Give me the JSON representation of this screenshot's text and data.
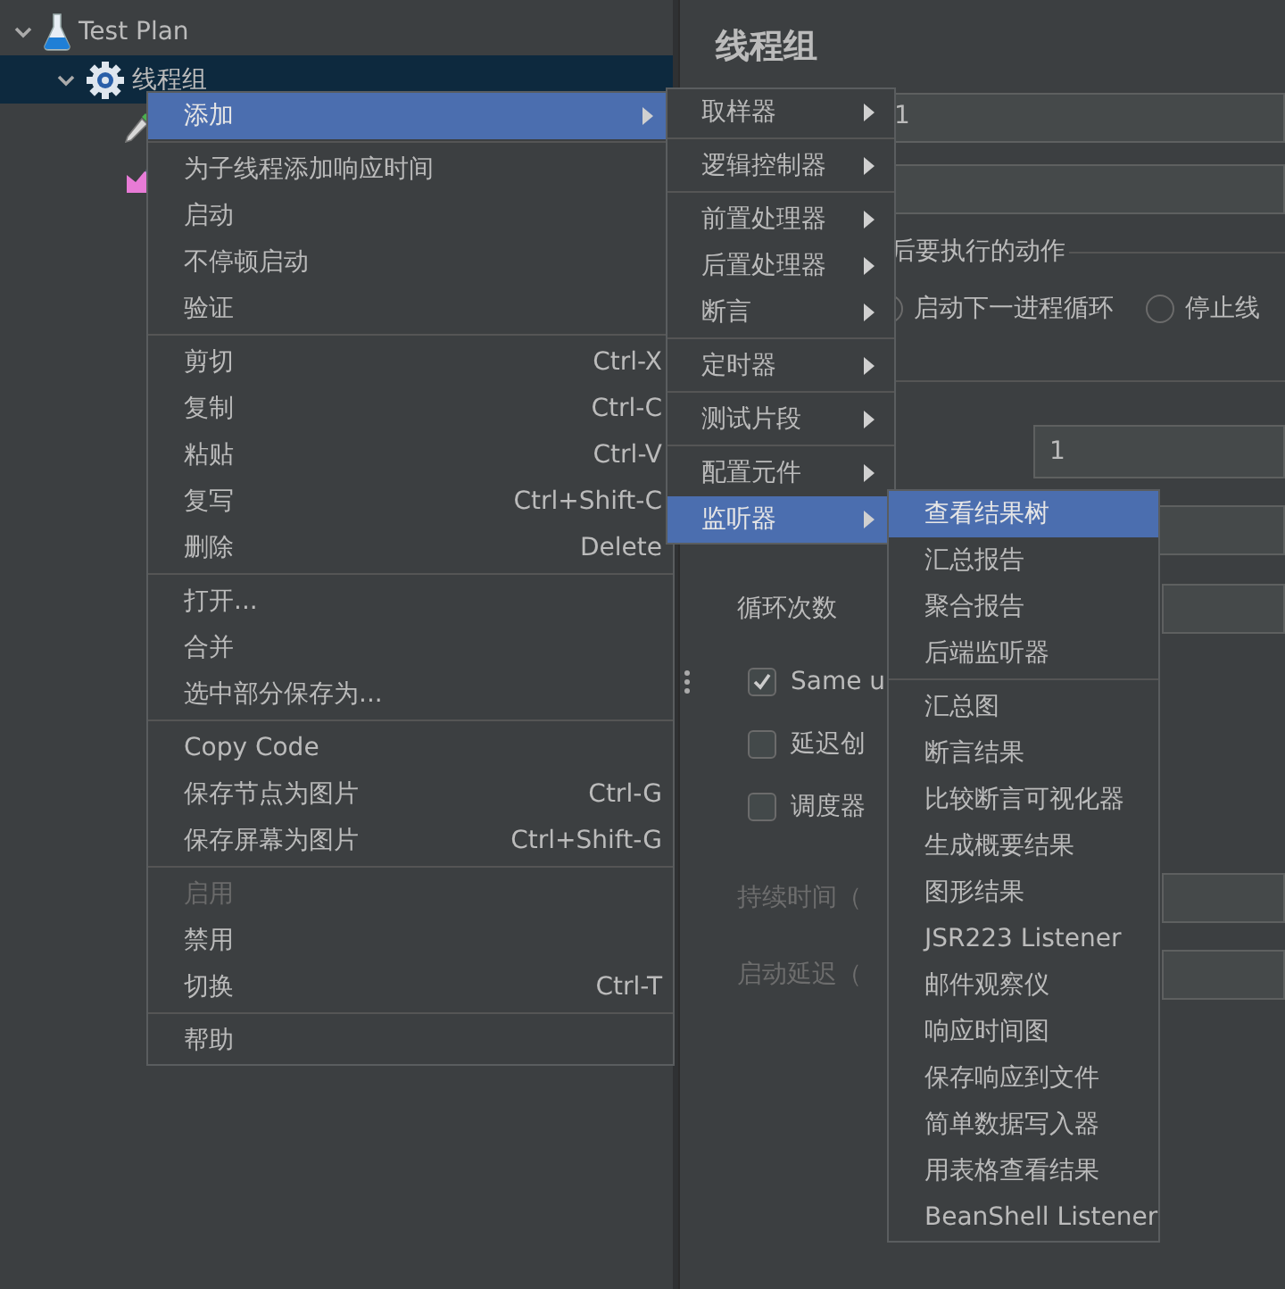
{
  "tree": {
    "items": [
      {
        "label": "Test Plan",
        "kind": "flask",
        "expanded": true,
        "selected": false,
        "children": [
          {
            "label": "线程组",
            "kind": "gear",
            "expanded": true,
            "selected": true,
            "children": [
              {
                "kind": "pipette",
                "selected": false
              },
              {
                "kind": "chart",
                "selected": false
              }
            ]
          }
        ]
      }
    ]
  },
  "panel": {
    "title": "线程组",
    "name_value": "1",
    "error_action": {
      "label": "后要执行的动作",
      "options": [
        {
          "label": "启动下一进程循环",
          "selected": false,
          "kind": "partial"
        },
        {
          "label": "停止线",
          "selected": false
        }
      ]
    },
    "ramp_value": "1",
    "loop_label": "循环次数",
    "checkboxes": [
      {
        "label": "Same u",
        "checked": true
      },
      {
        "label": "延迟创",
        "checked": false
      },
      {
        "label": "调度器",
        "checked": false
      }
    ],
    "disabled_labels": [
      "持续时间（",
      "启动延迟（"
    ]
  },
  "context_menu": {
    "groups": [
      [
        {
          "label": "添加",
          "submenu": true,
          "selected": true,
          "disabled": false
        }
      ],
      [
        {
          "label": "为子线程添加响应时间",
          "submenu": false,
          "selected": false,
          "disabled": false
        },
        {
          "label": "启动",
          "submenu": false,
          "selected": false,
          "disabled": false
        },
        {
          "label": "不停顿启动",
          "submenu": false,
          "selected": false,
          "disabled": false
        },
        {
          "label": "验证",
          "submenu": false,
          "selected": false,
          "disabled": false
        }
      ],
      [
        {
          "label": "剪切",
          "shortcut": "Ctrl-X",
          "submenu": false,
          "selected": false,
          "disabled": false
        },
        {
          "label": "复制",
          "shortcut": "Ctrl-C",
          "submenu": false,
          "selected": false,
          "disabled": false
        },
        {
          "label": "粘贴",
          "shortcut": "Ctrl-V",
          "submenu": false,
          "selected": false,
          "disabled": false
        },
        {
          "label": "复写",
          "shortcut": "Ctrl+Shift-C",
          "submenu": false,
          "selected": false,
          "disabled": false
        },
        {
          "label": "删除",
          "shortcut": "Delete",
          "submenu": false,
          "selected": false,
          "disabled": false
        }
      ],
      [
        {
          "label": "打开...",
          "submenu": false,
          "selected": false,
          "disabled": false
        },
        {
          "label": "合并",
          "submenu": false,
          "selected": false,
          "disabled": false
        },
        {
          "label": "选中部分保存为...",
          "submenu": false,
          "selected": false,
          "disabled": false
        }
      ],
      [
        {
          "label": "Copy Code",
          "submenu": false,
          "selected": false,
          "disabled": false
        },
        {
          "label": "保存节点为图片",
          "shortcut": "Ctrl-G",
          "submenu": false,
          "selected": false,
          "disabled": false
        },
        {
          "label": "保存屏幕为图片",
          "shortcut": "Ctrl+Shift-G",
          "submenu": false,
          "selected": false,
          "disabled": false
        }
      ],
      [
        {
          "label": "启用",
          "submenu": false,
          "selected": false,
          "disabled": true
        },
        {
          "label": "禁用",
          "submenu": false,
          "selected": false,
          "disabled": false
        },
        {
          "label": "切换",
          "shortcut": "Ctrl-T",
          "submenu": false,
          "selected": false,
          "disabled": false
        }
      ],
      [
        {
          "label": "帮助",
          "submenu": false,
          "selected": false,
          "disabled": false
        }
      ]
    ]
  },
  "add_submenu": {
    "groups": [
      [
        {
          "label": "取样器",
          "submenu": true,
          "selected": false
        }
      ],
      [
        {
          "label": "逻辑控制器",
          "submenu": true,
          "selected": false
        }
      ],
      [
        {
          "label": "前置处理器",
          "submenu": true,
          "selected": false
        },
        {
          "label": "后置处理器",
          "submenu": true,
          "selected": false
        },
        {
          "label": "断言",
          "submenu": true,
          "selected": false
        }
      ],
      [
        {
          "label": "定时器",
          "submenu": true,
          "selected": false
        }
      ],
      [
        {
          "label": "测试片段",
          "submenu": true,
          "selected": false
        }
      ],
      [
        {
          "label": "配置元件",
          "submenu": true,
          "selected": false
        },
        {
          "label": "监听器",
          "submenu": true,
          "selected": true
        }
      ]
    ]
  },
  "listener_submenu": {
    "groups": [
      [
        {
          "label": "查看结果树",
          "submenu": false,
          "selected": true
        },
        {
          "label": "汇总报告",
          "submenu": false,
          "selected": false
        },
        {
          "label": "聚合报告",
          "submenu": false,
          "selected": false
        },
        {
          "label": "后端监听器",
          "submenu": false,
          "selected": false
        }
      ],
      [
        {
          "label": "汇总图",
          "submenu": false,
          "selected": false
        },
        {
          "label": "断言结果",
          "submenu": false,
          "selected": false
        },
        {
          "label": "比较断言可视化器",
          "submenu": false,
          "selected": false
        },
        {
          "label": "生成概要结果",
          "submenu": false,
          "selected": false
        },
        {
          "label": "图形结果",
          "submenu": false,
          "selected": false
        },
        {
          "label": "JSR223 Listener",
          "submenu": false,
          "selected": false
        },
        {
          "label": "邮件观察仪",
          "submenu": false,
          "selected": false
        },
        {
          "label": "响应时间图",
          "submenu": false,
          "selected": false
        },
        {
          "label": "保存响应到文件",
          "submenu": false,
          "selected": false
        },
        {
          "label": "简单数据写入器",
          "submenu": false,
          "selected": false
        },
        {
          "label": "用表格查看结果",
          "submenu": false,
          "selected": false
        },
        {
          "label": "BeanShell Listener",
          "submenu": false,
          "selected": false
        }
      ]
    ]
  }
}
